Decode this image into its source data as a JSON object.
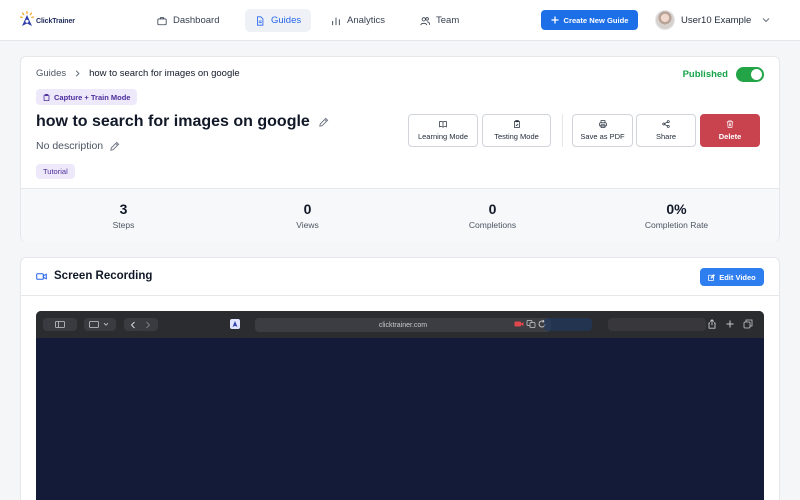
{
  "app": {
    "name": "ClickTrainer"
  },
  "nav": {
    "items": [
      {
        "label": "Dashboard",
        "icon": "briefcase-icon"
      },
      {
        "label": "Guides",
        "icon": "document-icon",
        "active": true
      },
      {
        "label": "Analytics",
        "icon": "bar-chart-icon"
      },
      {
        "label": "Team",
        "icon": "users-icon"
      }
    ],
    "create_label": "Create New Guide",
    "user_name": "User10 Example"
  },
  "guide": {
    "breadcrumb_root": "Guides",
    "breadcrumb_current": "how to search for images on google",
    "status_label": "Published",
    "status_on": true,
    "mode_badge": "Capture + Train Mode",
    "title": "how to search for images on google",
    "description": "No description",
    "tag": "Tutorial",
    "actions": {
      "learning": "Learning Mode",
      "testing": "Testing Mode",
      "pdf": "Save as PDF",
      "share": "Share",
      "delete": "Delete"
    },
    "stats": [
      {
        "value": "3",
        "label": "Steps"
      },
      {
        "value": "0",
        "label": "Views"
      },
      {
        "value": "0",
        "label": "Completions"
      },
      {
        "value": "0%",
        "label": "Completion Rate"
      }
    ]
  },
  "recording": {
    "title": "Screen Recording",
    "edit_label": "Edit Video",
    "url": "clicktrainer.com"
  },
  "colors": {
    "primary": "#1d6fe8",
    "success": "#22a447",
    "danger": "#c9434f",
    "badge_bg": "#ede9fb",
    "video_bg": "#141b38"
  }
}
